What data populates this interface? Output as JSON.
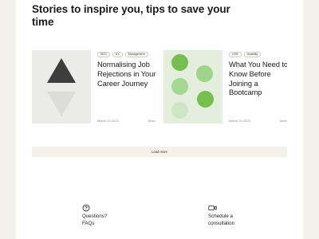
{
  "heading": "Stories to inspire you, tips to save your time",
  "cards": [
    {
      "tags": [
        "SEO",
        "UX",
        "Management"
      ],
      "title": "Normalising Job Rejections in Your Career Journey",
      "date": "March 24,2023",
      "read_time": "8min",
      "thumbnail": "triangles-illustration"
    },
    {
      "tags": [
        "UXR",
        "Usability"
      ],
      "title": "What You Need to Know Before Joining a Bootcamp",
      "date": "March 24,2023",
      "read_time": "8min",
      "thumbnail": "green-dots-illustration"
    }
  ],
  "load_more_label": "Load more",
  "support": [
    {
      "icon": "question-circle-icon",
      "label_line1": "Questions?",
      "label_line2": "FAQs"
    },
    {
      "icon": "video-camera-icon",
      "label_line1": "Schedule a",
      "label_line2": "consultation"
    }
  ],
  "colors": {
    "side_panel": "#f4f1eb",
    "load_more_bg": "#f4f1e8",
    "thumb_grey": "#ebebe9",
    "thumb_green": "#e3efdc",
    "green_dark": "#74c04f",
    "green_mid": "#9ed58a",
    "green_light": "#bfe0b0"
  }
}
